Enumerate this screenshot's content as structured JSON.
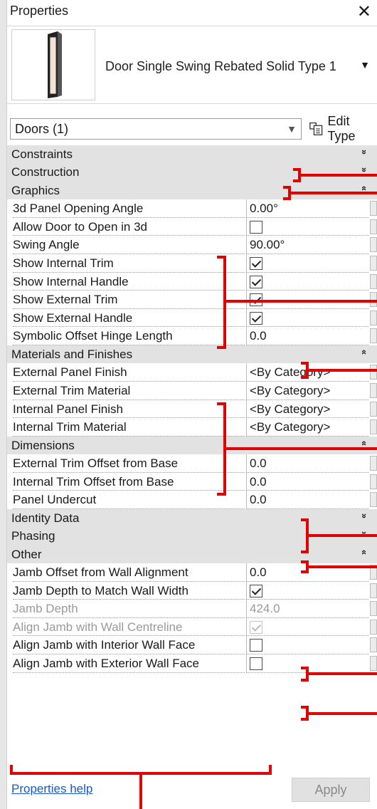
{
  "window": {
    "title": "Properties",
    "close_glyph": "✕"
  },
  "type_selector": {
    "name": "Door Single Swing Rebated Solid Type 1",
    "caret": "▼"
  },
  "filter": {
    "value": "Doors (1)",
    "caret": "▼",
    "edit_type_label": "Edit Type"
  },
  "sections": [
    {
      "name": "Constraints",
      "chevron": "»",
      "expanded": false,
      "rows": []
    },
    {
      "name": "Construction",
      "chevron": "»",
      "expanded": false,
      "rows": []
    },
    {
      "name": "Graphics",
      "chevron": "«",
      "expanded": true,
      "rows": [
        {
          "name": "3d Panel Opening Angle",
          "type": "text",
          "value": "0.00°"
        },
        {
          "name": "Allow Door to Open in 3d",
          "type": "checkbox",
          "checked": false
        },
        {
          "name": "Swing Angle",
          "type": "text",
          "value": "90.00°"
        },
        {
          "name": "Show Internal Trim",
          "type": "checkbox",
          "checked": true
        },
        {
          "name": "Show Internal Handle",
          "type": "checkbox",
          "checked": true
        },
        {
          "name": "Show External Trim",
          "type": "checkbox",
          "checked": true
        },
        {
          "name": "Show External Handle",
          "type": "checkbox",
          "checked": true
        },
        {
          "name": "Symbolic Offset Hinge Length",
          "type": "text",
          "value": "0.0"
        }
      ]
    },
    {
      "name": "Materials and Finishes",
      "chevron": "«",
      "expanded": true,
      "rows": [
        {
          "name": "External Panel Finish",
          "type": "text",
          "value": "<By Category>"
        },
        {
          "name": "External Trim Material",
          "type": "text",
          "value": "<By Category>"
        },
        {
          "name": "Internal Panel Finish",
          "type": "text",
          "value": "<By Category>"
        },
        {
          "name": "Internal Trim Material",
          "type": "text",
          "value": "<By Category>"
        }
      ]
    },
    {
      "name": "Dimensions",
      "chevron": "«",
      "expanded": true,
      "rows": [
        {
          "name": "External Trim Offset from Base",
          "type": "text",
          "value": "0.0"
        },
        {
          "name": "Internal Trim Offset from Base",
          "type": "text",
          "value": "0.0"
        },
        {
          "name": "Panel Undercut",
          "type": "text",
          "value": "0.0"
        }
      ]
    },
    {
      "name": "Identity Data",
      "chevron": "»",
      "expanded": false,
      "rows": []
    },
    {
      "name": "Phasing",
      "chevron": "»",
      "expanded": false,
      "rows": []
    },
    {
      "name": "Other",
      "chevron": "«",
      "expanded": true,
      "rows": [
        {
          "name": "Jamb Offset from Wall Alignment",
          "type": "text",
          "value": "0.0"
        },
        {
          "name": "Jamb Depth to Match Wall Width",
          "type": "checkbox",
          "checked": true
        },
        {
          "name": "Jamb Depth",
          "type": "text",
          "value": "424.0",
          "disabled": true
        },
        {
          "name": "Align Jamb with Wall Centreline",
          "type": "checkbox",
          "checked": true,
          "disabled": true
        },
        {
          "name": "Align Jamb with Interior Wall Face",
          "type": "checkbox",
          "checked": false
        },
        {
          "name": "Align Jamb with Exterior Wall Face",
          "type": "checkbox",
          "checked": false
        }
      ]
    }
  ],
  "footer": {
    "help_label": "Properties help",
    "apply_label": "Apply"
  },
  "colors": {
    "annotation": "#e00000",
    "category_bg": "#e2e2e2",
    "link": "#1a58c0"
  }
}
